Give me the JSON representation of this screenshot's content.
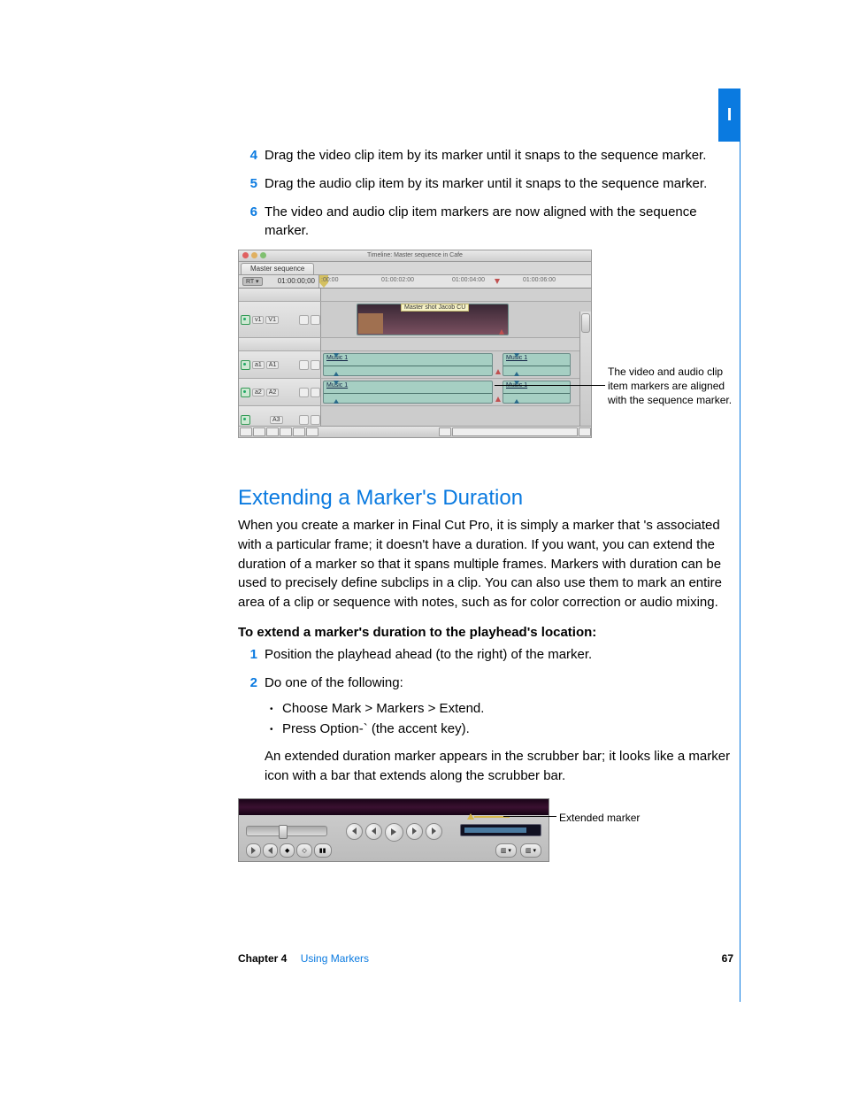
{
  "tab_label": "I",
  "steps_top": [
    {
      "n": "4",
      "t": "Drag the video clip item by its marker until it snaps to the sequence marker."
    },
    {
      "n": "5",
      "t": "Drag the audio clip item by its marker until it snaps to the sequence marker."
    },
    {
      "n": "6",
      "t": "The video and audio clip item markers are now aligned with the sequence marker."
    }
  ],
  "fig1": {
    "window_title": "Timeline: Master sequence in Cafe",
    "tab": "Master sequence",
    "rt": "RT ▾",
    "timecode": "01:00:00;00",
    "ruler_times": [
      ":00:00",
      "01:00:02:00",
      "01:00:04:00",
      "01:00:06:00"
    ],
    "tracks": {
      "v1": {
        "src": "v1",
        "dst": "V1"
      },
      "a1": {
        "src": "a1",
        "dst": "A1"
      },
      "a2": {
        "src": "a2",
        "dst": "A2"
      },
      "a3": {
        "dst": "A3"
      }
    },
    "clips": {
      "video": "Master shot Jacob CU",
      "a1a": "Music 1",
      "a1b": "Music 1",
      "a2a": "Music 1",
      "a2b": "Music 1"
    },
    "callout": "The video and audio clip item markers are aligned with the sequence marker."
  },
  "section_heading": "Extending a Marker's Duration",
  "section_body": "When you create a marker in Final Cut Pro, it is simply a marker that 's associated with a particular frame; it doesn't have a duration. If you want, you can extend the duration of a marker so that it spans multiple frames. Markers with duration can be used to precisely define subclips in a clip. You can also use them to mark an entire area of a clip or sequence with notes, such as for color correction or audio mixing.",
  "lead": "To extend a marker's duration to the playhead's location:",
  "steps_bottom": [
    {
      "n": "1",
      "t": "Position the playhead ahead (to the right) of the marker."
    },
    {
      "n": "2",
      "t": "Do one of the following:"
    }
  ],
  "bullets": [
    "Choose Mark > Markers > Extend.",
    "Press Option-` (the accent key)."
  ],
  "after_bullets": "An extended duration marker appears in the scrubber bar; it looks like a marker icon with a bar that extends along the scrubber bar.",
  "fig2": {
    "callout": "Extended marker"
  },
  "footer": {
    "chapter": "Chapter 4",
    "title": "Using Markers",
    "page": "67"
  }
}
